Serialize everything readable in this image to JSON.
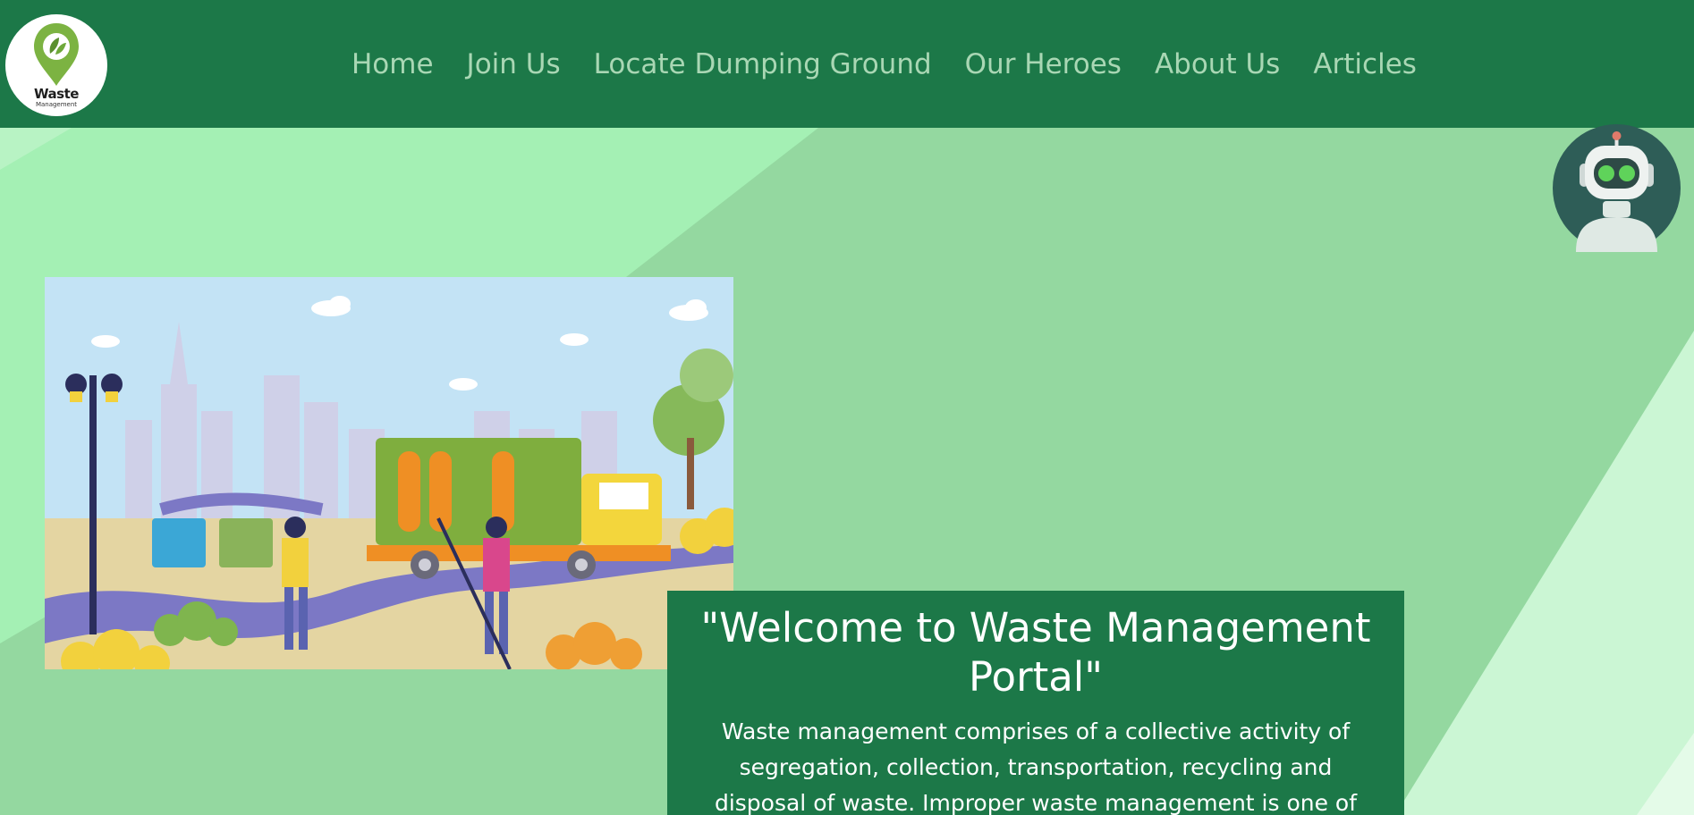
{
  "brand": {
    "logo_title": "Waste",
    "logo_subtitle": "Management",
    "icon": "leaf-location-pin-icon"
  },
  "nav": {
    "items": [
      {
        "label": "Home"
      },
      {
        "label": "Join Us"
      },
      {
        "label": "Locate Dumping Ground"
      },
      {
        "label": "Our Heroes"
      },
      {
        "label": "About Us"
      },
      {
        "label": "Articles"
      }
    ]
  },
  "chatbot": {
    "icon": "robot-icon"
  },
  "hero": {
    "image_icon": "garbage-truck-city-illustration"
  },
  "welcome": {
    "heading": "\"Welcome to Waste Management Portal\"",
    "body": "Waste management comprises of a collective activity of segregation, collection, transportation, recycling and disposal of waste. Improper waste management is one of"
  },
  "colors": {
    "primary": "#1c7848",
    "nav_text": "#a9d7b4",
    "background": "#94d8a0",
    "band_light": "#a4f0b4",
    "band_pale": "#cbf6d4",
    "bot_bg": "#2e5d57"
  }
}
